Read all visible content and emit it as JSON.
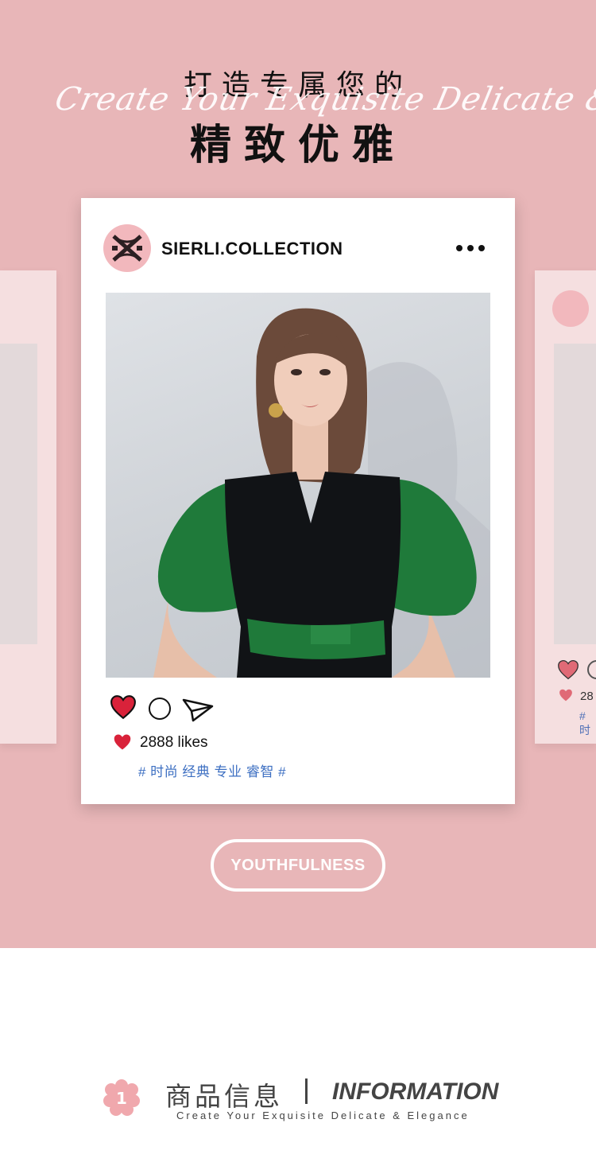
{
  "hero": {
    "line1": "打造专属您的",
    "script": "Create Your Exquisite Delicate & Elegance",
    "line2": "精致优雅"
  },
  "post": {
    "handle": "SIERLI.COLLECTION",
    "more_icon": "more-horizontal-icon",
    "likes_text": "2888 likes",
    "tags": "# 时尚 经典 专业 睿智 #",
    "colors": {
      "heart": "#d9223a",
      "tag": "#3d6fc2"
    }
  },
  "ghost_right": {
    "likes_text": "28",
    "tag_text": "# 时"
  },
  "badge": {
    "label": "YOUTHFULNESS"
  },
  "section": {
    "number": "1",
    "title_cn": "商品信息",
    "title_en": "INFORMATION",
    "subtitle": "Create Your Exquisite Delicate & Elegance"
  },
  "colors": {
    "pink_bg": "#e8b6b8",
    "card_bg": "#ffffff",
    "avatar_bg": "#f2b8bd"
  }
}
